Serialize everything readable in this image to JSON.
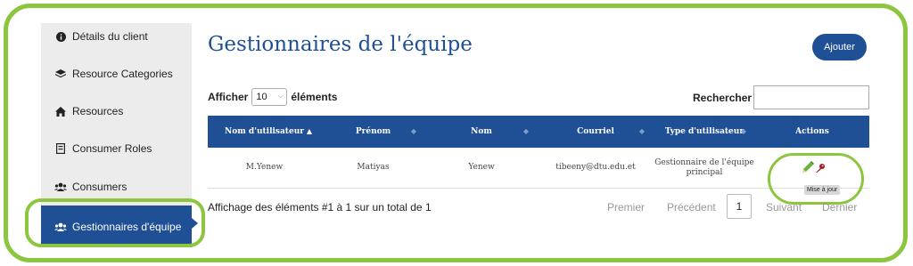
{
  "sidebar": {
    "items": [
      {
        "label": "Détails du client",
        "icon": "info-circle-icon"
      },
      {
        "label": "Resource Categories",
        "icon": "layers-icon"
      },
      {
        "label": "Resources",
        "icon": "home-icon"
      },
      {
        "label": "Consumer Roles",
        "icon": "id-card-icon"
      },
      {
        "label": "Consumers",
        "icon": "users-icon"
      },
      {
        "label": "Gestionnaires d'équipe",
        "icon": "users-icon",
        "active": true
      }
    ]
  },
  "header": {
    "title": "Gestionnaires de l'équipe",
    "add_label": "Ajouter"
  },
  "controls": {
    "show_prefix": "Afficher",
    "show_value": "10",
    "show_suffix": "éléments",
    "search_label": "Rechercher :",
    "search_value": ""
  },
  "table": {
    "columns": [
      "Nom d'utilisateur",
      "Prénom",
      "Nom",
      "Courriel",
      "Type d'utilisateur",
      "Actions"
    ],
    "sorted_column": "Nom d'utilisateur",
    "rows": [
      {
        "username": "M.Yenew",
        "first_name": "Matiyas",
        "last_name": "Yenew",
        "email": "tibeeny@dtu.edu.et",
        "user_type": "Gestionnaire de l'équipe principal"
      }
    ],
    "actions": {
      "edit_icon": "pencil-icon",
      "key_icon": "key-icon",
      "tooltip": "Mise à jour"
    }
  },
  "footer": {
    "info": "Affichage des éléments #1 à 1 sur un total de 1",
    "first": "Premier",
    "previous": "Précédent",
    "current_page": "1",
    "next": "Suivant",
    "last": "Dernier"
  },
  "colors": {
    "primary": "#1f4f95",
    "highlight": "#8cc63f",
    "sidebar_bg": "#ececec"
  }
}
